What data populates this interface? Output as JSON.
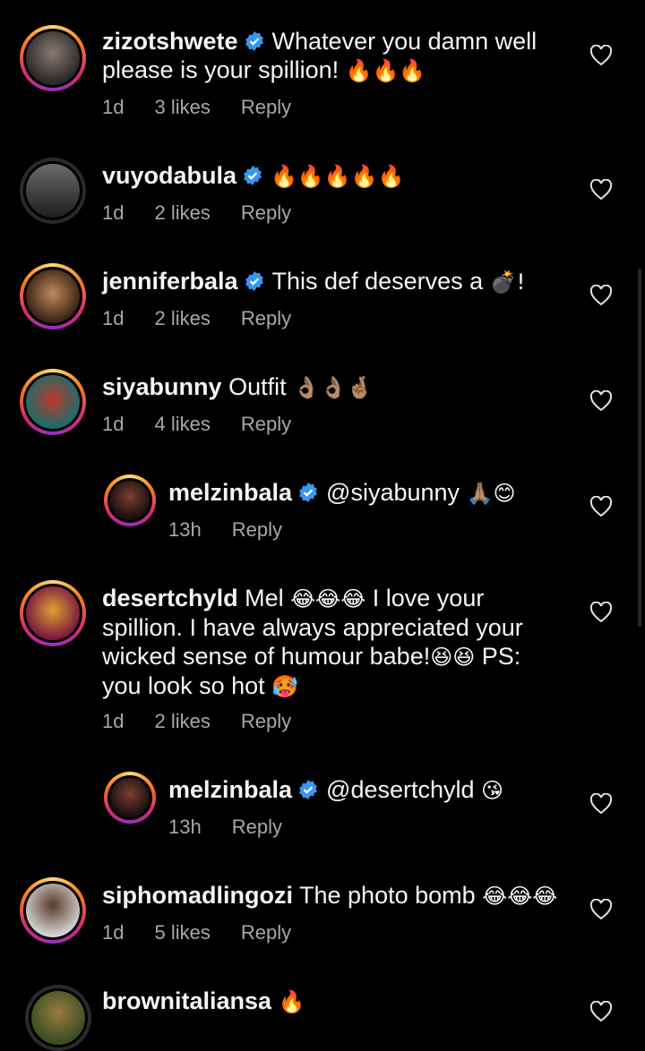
{
  "colors": {
    "background": "#000000",
    "text": "#f5f5f5",
    "meta": "#a8a8a8",
    "verified": "#3897f0"
  },
  "comments": [
    {
      "username": "zizotshwete",
      "verified": true,
      "text": "Whatever you damn well please is your spillion!",
      "emoji": "🔥🔥🔥",
      "time": "1d",
      "likes": "3 likes",
      "reply": "Reply"
    },
    {
      "username": "vuyodabula",
      "verified": true,
      "text": "",
      "emoji": "🔥🔥🔥🔥🔥",
      "time": "1d",
      "likes": "2 likes",
      "reply": "Reply"
    },
    {
      "username": "jenniferbala",
      "verified": true,
      "text": "This def deserves a",
      "emoji": "💣!",
      "time": "1d",
      "likes": "2 likes",
      "reply": "Reply"
    },
    {
      "username": "siyabunny",
      "verified": false,
      "text": "Outfit",
      "emoji": "👌🏽👌🏽🤞🏽",
      "time": "1d",
      "likes": "4 likes",
      "reply": "Reply"
    },
    {
      "username": "melzinbala",
      "verified": true,
      "text": "@siyabunny",
      "emoji": "🙏🏽😊",
      "time": "13h",
      "likes": "",
      "reply": "Reply"
    },
    {
      "username": "desertchyld",
      "verified": false,
      "text_line1": "Mel",
      "emoji1": "😂😂😂",
      "text_line1b": "I love your",
      "text_line2": "spillion. I have always appreciated your",
      "text_line3": "wicked sense of humour babe!",
      "emoji3": "😆😆",
      "text_line3b": "PS:",
      "text_line4": "you look so hot",
      "emoji4": "🥵",
      "time": "1d",
      "likes": "2 likes",
      "reply": "Reply"
    },
    {
      "username": "melzinbala",
      "verified": true,
      "text": "@desertchyld",
      "emoji": "😘",
      "time": "13h",
      "likes": "",
      "reply": "Reply"
    },
    {
      "username": "siphomadlingozi",
      "verified": false,
      "text": "The photo bomb",
      "emoji": "😂😂😂",
      "time": "1d",
      "likes": "5 likes",
      "reply": "Reply"
    },
    {
      "username": "brownitaliansa",
      "verified": false,
      "text": "",
      "emoji": "🔥",
      "time": "",
      "likes": "",
      "reply": ""
    }
  ]
}
